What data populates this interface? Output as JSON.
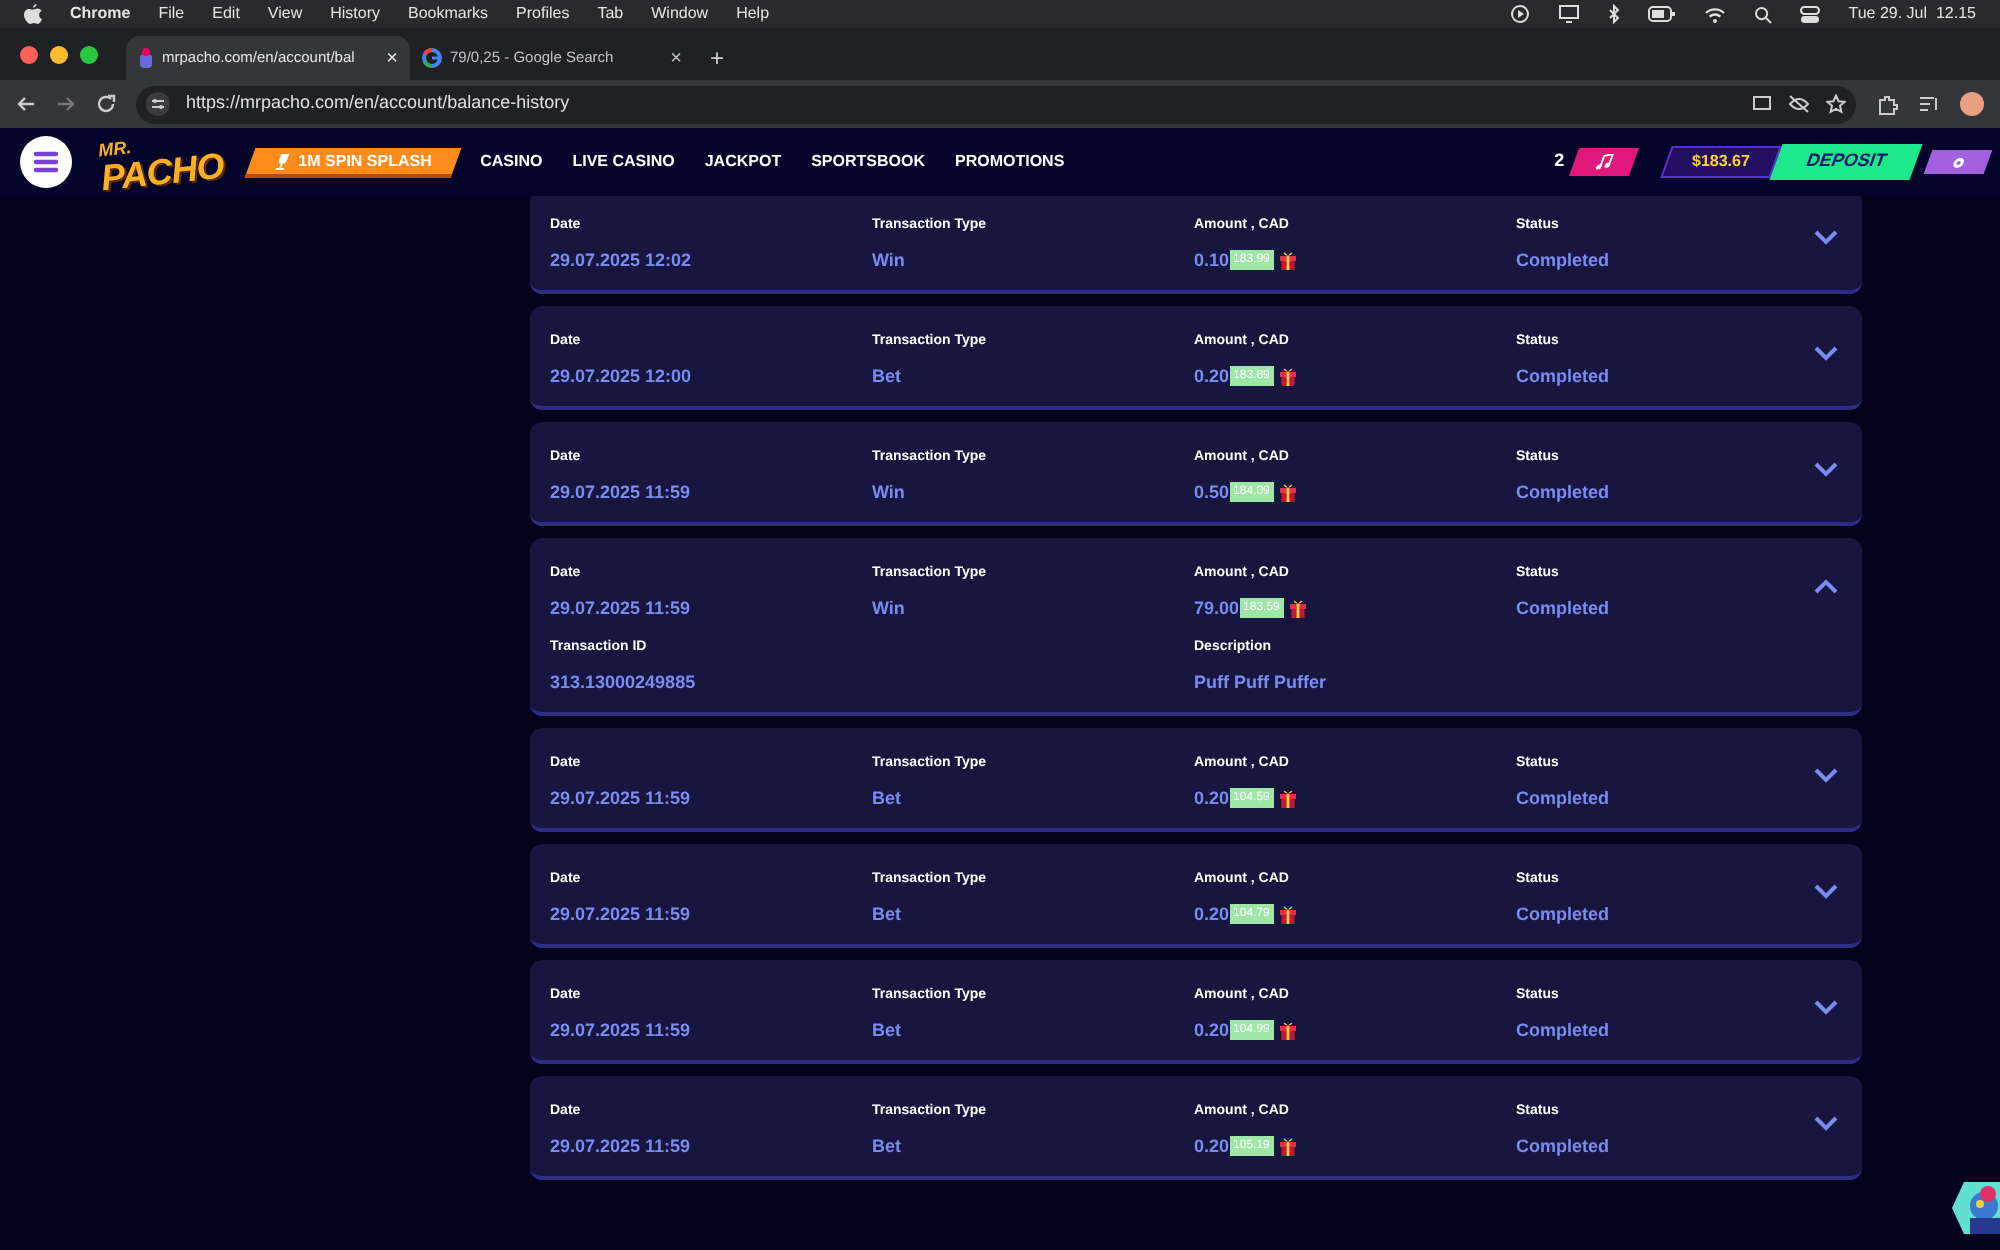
{
  "menu_bar": {
    "app": "Chrome",
    "items": [
      "File",
      "Edit",
      "View",
      "History",
      "Bookmarks",
      "Profiles",
      "Tab",
      "Window",
      "Help"
    ],
    "clock": "Tue 29. Jul  12.15"
  },
  "tabs": [
    {
      "title": "mrpacho.com/en/account/bal",
      "selected": true,
      "close": "×"
    },
    {
      "title": "79/0,25 - Google Search",
      "selected": false,
      "close": "×"
    }
  ],
  "new_tab": "+",
  "address": "https://mrpacho.com/en/account/balance-history",
  "site": {
    "logo_top": "MR.",
    "logo_main": "PACHO",
    "promo": "1M SPIN SPLASH",
    "nav": [
      "CASINO",
      "LIVE CASINO",
      "JACKPOT",
      "SPORTSBOOK",
      "PROMOTIONS"
    ],
    "count": "2",
    "balance": "$183.67",
    "deposit": "DEPOSIT"
  },
  "transactions": [
    {
      "date_label": "Date",
      "date": "29.07.2025 12:02",
      "type_label": "Transaction Type",
      "type": "Win",
      "amount_label": "Amount , CAD",
      "amount": "0.10",
      "balance": "183.99",
      "status_label": "Status",
      "status": "Completed",
      "expanded": false
    },
    {
      "date_label": "Date",
      "date": "29.07.2025 12:00",
      "type_label": "Transaction Type",
      "type": "Bet",
      "amount_label": "Amount , CAD",
      "amount": "0.20",
      "balance": "183.89",
      "status_label": "Status",
      "status": "Completed",
      "expanded": false
    },
    {
      "date_label": "Date",
      "date": "29.07.2025 11:59",
      "type_label": "Transaction Type",
      "type": "Win",
      "amount_label": "Amount , CAD",
      "amount": "0.50",
      "balance": "184.09",
      "status_label": "Status",
      "status": "Completed",
      "expanded": false
    },
    {
      "date_label": "Date",
      "date": "29.07.2025 11:59",
      "type_label": "Transaction Type",
      "type": "Win",
      "amount_label": "Amount , CAD",
      "amount": "79.00",
      "balance": "183.59",
      "status_label": "Status",
      "status": "Completed",
      "expanded": true,
      "id_label": "Transaction ID",
      "id": "313.13000249885",
      "description_label": "Description",
      "description": "Puff Puff Puffer"
    },
    {
      "date_label": "Date",
      "date": "29.07.2025 11:59",
      "type_label": "Transaction Type",
      "type": "Bet",
      "amount_label": "Amount , CAD",
      "amount": "0.20",
      "balance": "104.59",
      "status_label": "Status",
      "status": "Completed",
      "expanded": false
    },
    {
      "date_label": "Date",
      "date": "29.07.2025 11:59",
      "type_label": "Transaction Type",
      "type": "Bet",
      "amount_label": "Amount , CAD",
      "amount": "0.20",
      "balance": "104.79",
      "status_label": "Status",
      "status": "Completed",
      "expanded": false
    },
    {
      "date_label": "Date",
      "date": "29.07.2025 11:59",
      "type_label": "Transaction Type",
      "type": "Bet",
      "amount_label": "Amount , CAD",
      "amount": "0.20",
      "balance": "104.99",
      "status_label": "Status",
      "status": "Completed",
      "expanded": false
    },
    {
      "date_label": "Date",
      "date": "29.07.2025 11:59",
      "type_label": "Transaction Type",
      "type": "Bet",
      "amount_label": "Amount , CAD",
      "amount": "0.20",
      "balance": "105.19",
      "status_label": "Status",
      "status": "Completed",
      "expanded": false
    }
  ]
}
